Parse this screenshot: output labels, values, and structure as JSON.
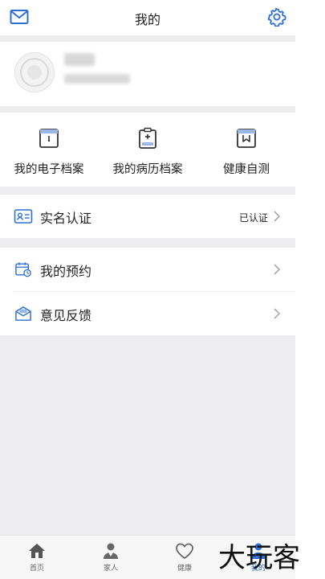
{
  "header": {
    "title": "我的"
  },
  "icons": {
    "mail": "mail-icon",
    "settings": "gear-icon"
  },
  "colors": {
    "accent": "#2c6fd6",
    "background": "#ededf0"
  },
  "quick_actions": [
    {
      "label": "我的电子档案",
      "icon": "folder-icon"
    },
    {
      "label": "我的病历档案",
      "icon": "medical-record-icon"
    },
    {
      "label": "健康自测",
      "icon": "bookmark-card-icon"
    }
  ],
  "verification": {
    "label": "实名认证",
    "status": "已认证"
  },
  "menu": [
    {
      "label": "我的预约",
      "icon": "calendar-clock-icon"
    },
    {
      "label": "意见反馈",
      "icon": "feedback-envelope-icon"
    }
  ],
  "tabs": [
    {
      "label": "首页",
      "icon": "home-icon"
    },
    {
      "label": "家人",
      "icon": "doctor-icon"
    },
    {
      "label": "健康",
      "icon": "heart-icon"
    },
    {
      "label": "我的",
      "icon": "person-icon"
    }
  ],
  "watermark": "大玩客"
}
